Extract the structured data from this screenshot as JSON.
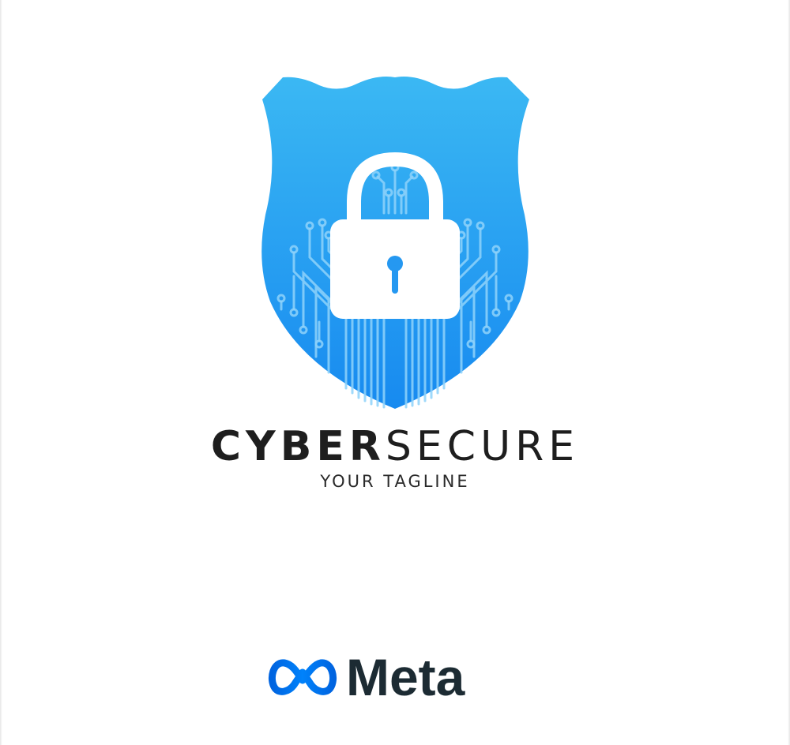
{
  "logo": {
    "wordmark_bold": "CYBER",
    "wordmark_light": "SECURE",
    "tagline": "YOUR TAGLINE",
    "shield_color_top": "#38b6f2",
    "shield_color_bottom": "#1a8cf0",
    "lock_color": "#ffffff",
    "lock_icon": "padlock-icon",
    "circuit_icon": "circuit-lines"
  },
  "watermark": {
    "brand_text": "Meta",
    "brand_color": "#0081fb",
    "icon": "meta-infinity-icon"
  }
}
